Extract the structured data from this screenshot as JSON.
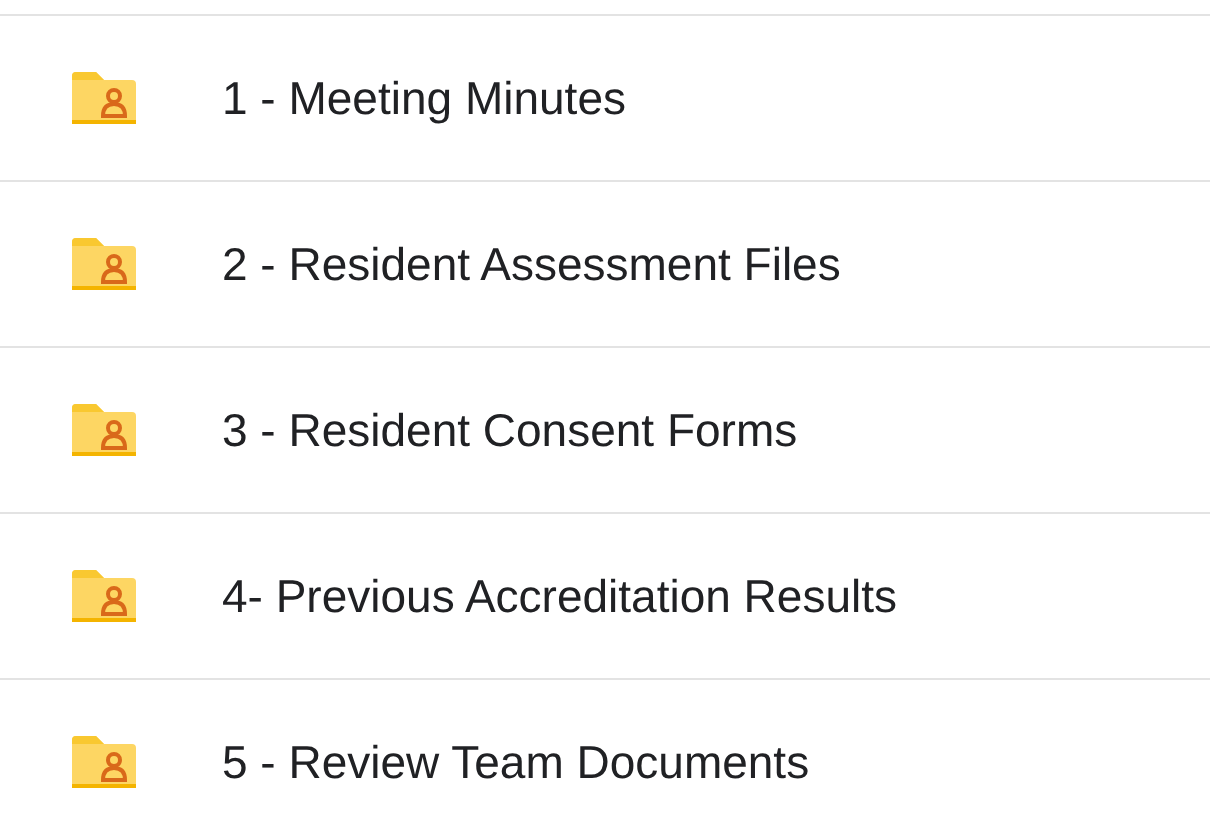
{
  "folders": [
    {
      "name": "1 - Meeting Minutes"
    },
    {
      "name": "2 - Resident Assessment Files"
    },
    {
      "name": "3 - Resident Consent Forms"
    },
    {
      "name": "4- Previous Accreditation Results"
    },
    {
      "name": "5 - Review Team Documents"
    }
  ]
}
